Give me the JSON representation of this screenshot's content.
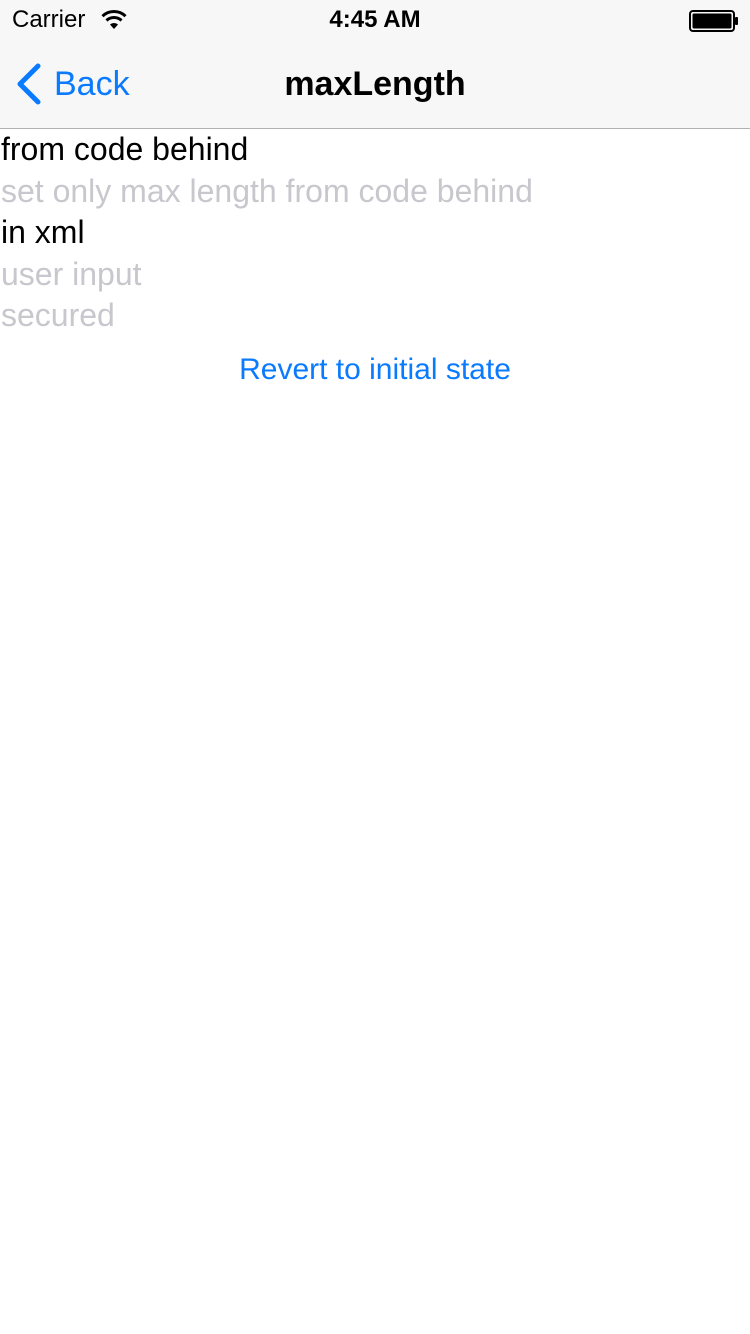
{
  "status_bar": {
    "carrier": "Carrier",
    "time": "4:45 AM",
    "wifi_icon": "wifi-icon",
    "battery_icon": "battery-full-icon"
  },
  "nav_bar": {
    "back_label": "Back",
    "back_icon": "chevron-left-icon",
    "title": "maxLength"
  },
  "fields": [
    {
      "name": "code-behind-field",
      "text": "from code behind",
      "state": "value"
    },
    {
      "name": "max-length-only-field",
      "text": "set only max length from code behind",
      "state": "placeholder"
    },
    {
      "name": "xml-field",
      "text": "in xml",
      "state": "value"
    },
    {
      "name": "user-input-field",
      "text": "user input",
      "state": "placeholder"
    },
    {
      "name": "secured-field",
      "text": "secured",
      "state": "placeholder"
    }
  ],
  "revert_button_label": "Revert to initial state",
  "colors": {
    "accent": "#0a7aff",
    "placeholder": "#c7c7cd",
    "bar_background": "#f7f7f7"
  }
}
